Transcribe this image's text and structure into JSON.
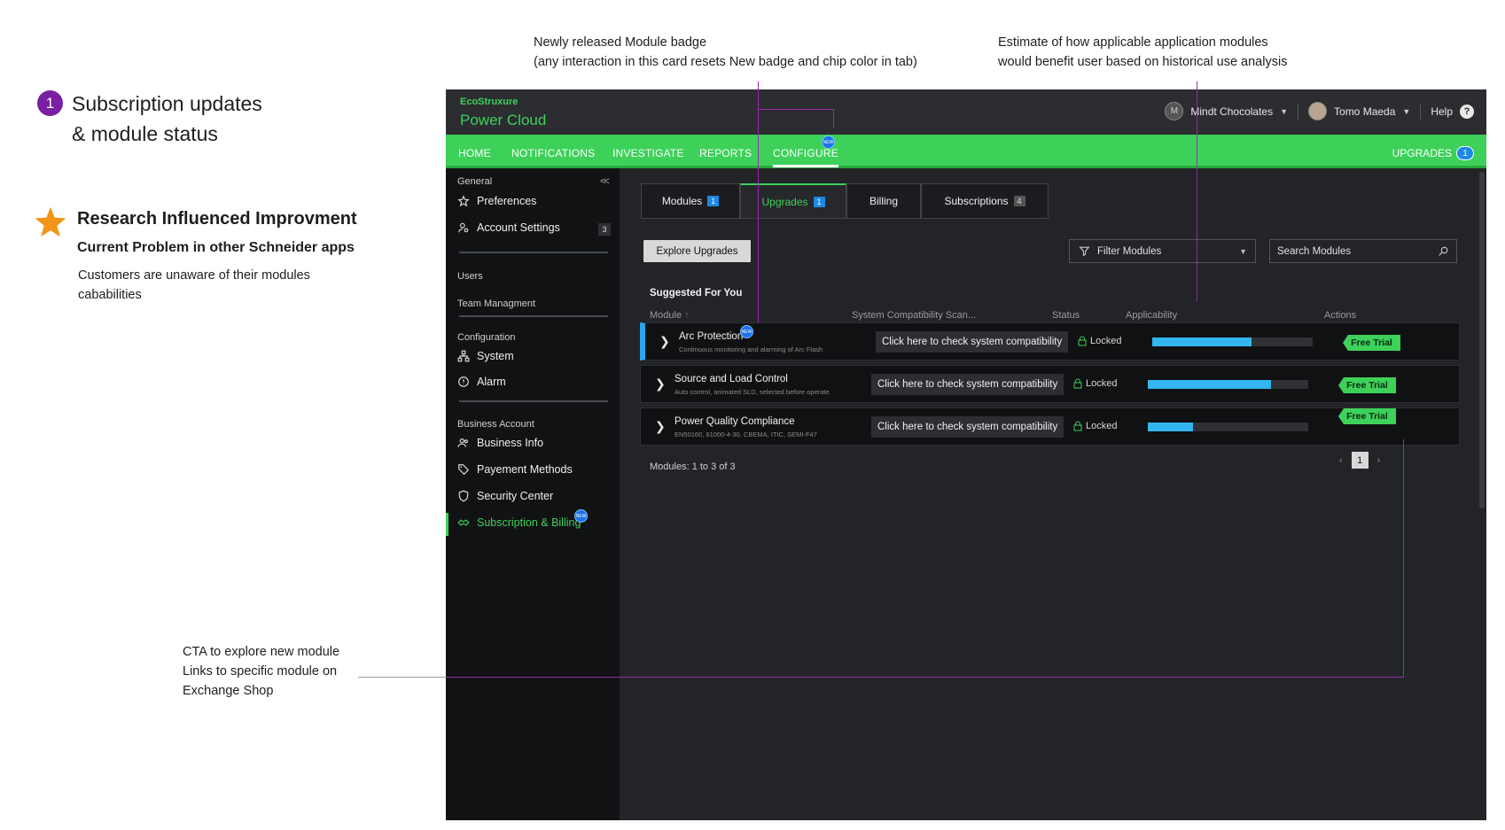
{
  "annotations": {
    "badge_number": "1",
    "title_line1": "Subscription updates",
    "title_line2": "& module status",
    "research_title": "Research Influenced Improvment",
    "research_subtitle": "Current Problem in other Schneider apps",
    "research_body": "Customers are unaware of their modules cababilities",
    "note_badge_line1": "Newly released Module badge",
    "note_badge_line2": "(any interaction in this card resets New badge and chip color in tab)",
    "note_estimate_line1": "Estimate of how applicable application modules",
    "note_estimate_line2": "would benefit user based on historical use analysis",
    "cta_line1": "CTA to explore new module",
    "cta_line2": "Links to specific module on",
    "cta_line3": "Exchange Shop",
    "colors": {
      "guide": "#9c27b0",
      "star": "#f29418",
      "badge": "#7b1fa2"
    }
  },
  "app": {
    "brand_small": "EcoStruxure",
    "brand_big": "Power Cloud",
    "org_name": "Mindt Chocolates",
    "org_avatar_initials": "M",
    "user_name": "Tomo Maeda",
    "help_label": "Help",
    "help_icon": "?",
    "nav": {
      "items": [
        "HOME",
        "NOTIFICATIONS",
        "INVESTIGATE",
        "REPORTS",
        "CONFIGURE"
      ],
      "active": "CONFIGURE",
      "new_badge": "NEW",
      "upgrades_label": "UPGRADES",
      "upgrades_count": "1"
    },
    "sidebar": {
      "collapse_icon": "<<",
      "general_label": "General",
      "preferences": "Preferences",
      "account_settings": "Account Settings",
      "account_settings_count": "3",
      "users": "Users",
      "team_management": "Team Managment",
      "configuration_label": "Configuration",
      "system": "System",
      "alarm": "Alarm",
      "business_account_label": "Business Account",
      "business_info": "Business Info",
      "payment_methods": "Payement Methods",
      "security_center": "Security Center",
      "subscription_billing": "Subscription & Billing",
      "new_badge": "NEW"
    },
    "tabs": [
      {
        "label": "Modules",
        "count": "1"
      },
      {
        "label": "Upgrades",
        "count": "1"
      },
      {
        "label": "Billing",
        "count": ""
      },
      {
        "label": "Subscriptions",
        "count": "4"
      }
    ],
    "explore_button": "Explore Upgrades",
    "filter_placeholder": "Filter Modules",
    "search_placeholder": "Search Modules",
    "suggested_heading": "Suggested For You",
    "columns": {
      "module": "Module",
      "compat": "System Compatibility Scan...",
      "status": "Status",
      "applicability": "Applicability",
      "actions": "Actions"
    },
    "rows": [
      {
        "name": "Arc Protection",
        "desc": "Continuous monitoring and alarming of Arc Flash",
        "compat": "Click here to check system compatibility",
        "status": "Locked",
        "applicability": 0.62,
        "action": "Free Trial",
        "new": "NEW"
      },
      {
        "name": "Source and Load Control",
        "desc": "Auto control, animated SLD, selected before operate",
        "compat": "Click here to check system compatibility",
        "status": "Locked",
        "applicability": 0.77,
        "action": "Free Trial"
      },
      {
        "name": "Power Quality Compliance",
        "desc": "EN50160, 61000-4-30, CBEMA, ITIC, SEMI-F47",
        "compat": "Click here to check system compatibility",
        "status": "Locked",
        "applicability": 0.28,
        "action": "Free Trial"
      }
    ],
    "footer_count": "Modules: 1 to 3 of 3",
    "page_current": "1",
    "colors": {
      "accent": "#3dd15a",
      "bar": "#33b5f0",
      "new_badge": "#1a73e8",
      "topbar": "#2b2d31"
    }
  }
}
